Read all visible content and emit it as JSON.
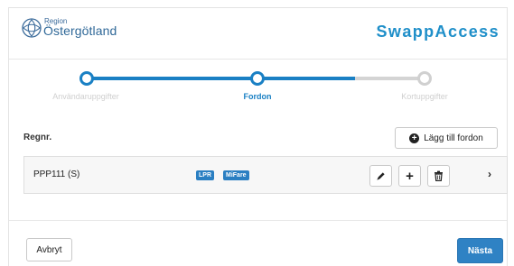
{
  "header": {
    "org_small": "Region",
    "org_name": "Östergötland",
    "app_name": "SwappAccess"
  },
  "stepper": {
    "steps": [
      {
        "label": "Användaruppgifter",
        "state": "done"
      },
      {
        "label": "Fordon",
        "state": "active"
      },
      {
        "label": "Kortuppgifter",
        "state": "todo"
      }
    ]
  },
  "list": {
    "column_header": "Regnr.",
    "add_button_label": "Lägg till fordon",
    "rows": [
      {
        "reg": "PPP111 (S)",
        "tags": [
          "LPR",
          "MiFare"
        ]
      }
    ]
  },
  "footer": {
    "cancel_label": "Avbryt",
    "next_label": "Nästa"
  },
  "colors": {
    "accent": "#1a80c4",
    "primary_button": "#2f82c4",
    "tag": "#2a7fc2",
    "inactive": "#d4d4d4"
  }
}
